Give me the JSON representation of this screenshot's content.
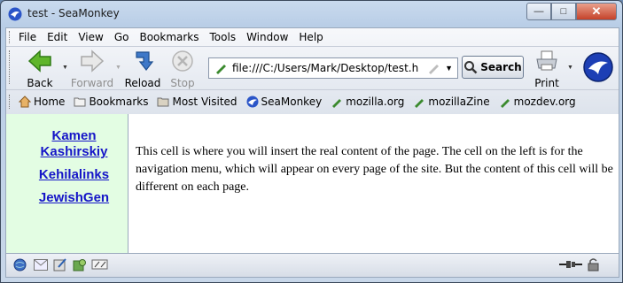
{
  "window": {
    "title": "test - SeaMonkey"
  },
  "menubar": {
    "items": [
      "File",
      "Edit",
      "View",
      "Go",
      "Bookmarks",
      "Tools",
      "Window",
      "Help"
    ]
  },
  "toolbar": {
    "back_label": "Back",
    "forward_label": "Forward",
    "reload_label": "Reload",
    "stop_label": "Stop",
    "print_label": "Print",
    "search_label": "Search",
    "url": "file:///C:/Users/Mark/Desktop/test.html"
  },
  "personal_toolbar": {
    "items": [
      "Home",
      "Bookmarks",
      "Most Visited",
      "SeaMonkey",
      "mozilla.org",
      "mozillaZine",
      "mozdev.org"
    ]
  },
  "page": {
    "nav_links": [
      "Kamen Kashirskiy",
      "Kehilalinks",
      "JewishGen"
    ],
    "main_text": "This cell is where you will insert the real content of the page. The cell on the left is for the navigation menu, which will appear on every page of the site. But the content of this cell will be different on each page."
  },
  "colors": {
    "nav_bg": "#e3fde3",
    "link": "#1515c8",
    "chrome": "#dde3ec"
  },
  "icons": [
    "back-arrow-icon",
    "forward-arrow-icon",
    "reload-icon",
    "stop-icon",
    "print-icon",
    "seamonkey-logo-icon",
    "home-icon",
    "folder-icon",
    "bookmark-icon"
  ]
}
